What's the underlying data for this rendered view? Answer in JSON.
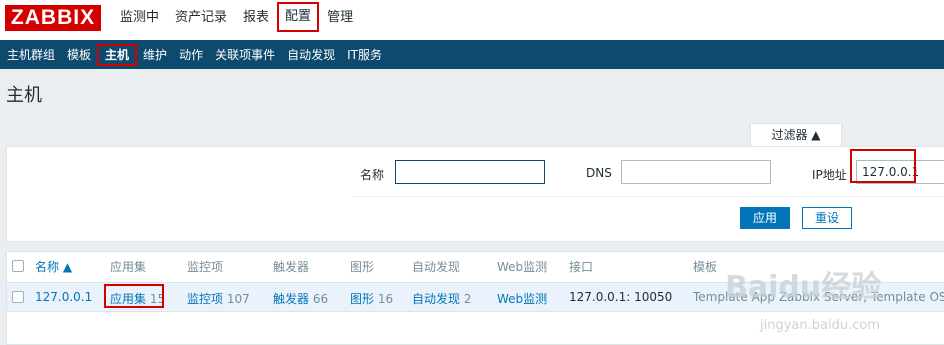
{
  "app": {
    "logo": "ZABBIX"
  },
  "top_menu": [
    "监测中",
    "资产记录",
    "报表",
    "配置",
    "管理"
  ],
  "sub_menu": [
    "主机群组",
    "模板",
    "主机",
    "维护",
    "动作",
    "关联项事件",
    "自动发现",
    "IT服务"
  ],
  "page": {
    "title": "主机"
  },
  "filter": {
    "tab_label": "过滤器 ▲",
    "name_label": "名称",
    "name_value": "",
    "dns_label": "DNS",
    "dns_value": "",
    "ip_label": "IP地址",
    "ip_value": "127.0.0.1",
    "apply_label": "应用",
    "reset_label": "重设"
  },
  "table": {
    "headers": [
      "名称 ▲",
      "应用集",
      "监控项",
      "触发器",
      "图形",
      "自动发现",
      "Web监测",
      "接口",
      "模板"
    ],
    "rows": [
      {
        "name": "127.0.0.1",
        "applications": "应用集",
        "applications_count": "15",
        "items": "监控项",
        "items_count": "107",
        "triggers": "触发器",
        "triggers_count": "66",
        "graphs": "图形",
        "graphs_count": "16",
        "discovery": "自动发现",
        "discovery_count": "2",
        "web": "Web监测",
        "interface": "127.0.0.1: 10050",
        "templates": "Template App Zabbix Server, Template OS Linux"
      }
    ]
  },
  "watermark": {
    "main": "Baidu经验",
    "sub": "jingyan.baidu.com"
  },
  "colors": {
    "brand": "#d40000",
    "nav": "#0e4a6d",
    "link": "#0275b8",
    "highlight": "#d40000"
  }
}
